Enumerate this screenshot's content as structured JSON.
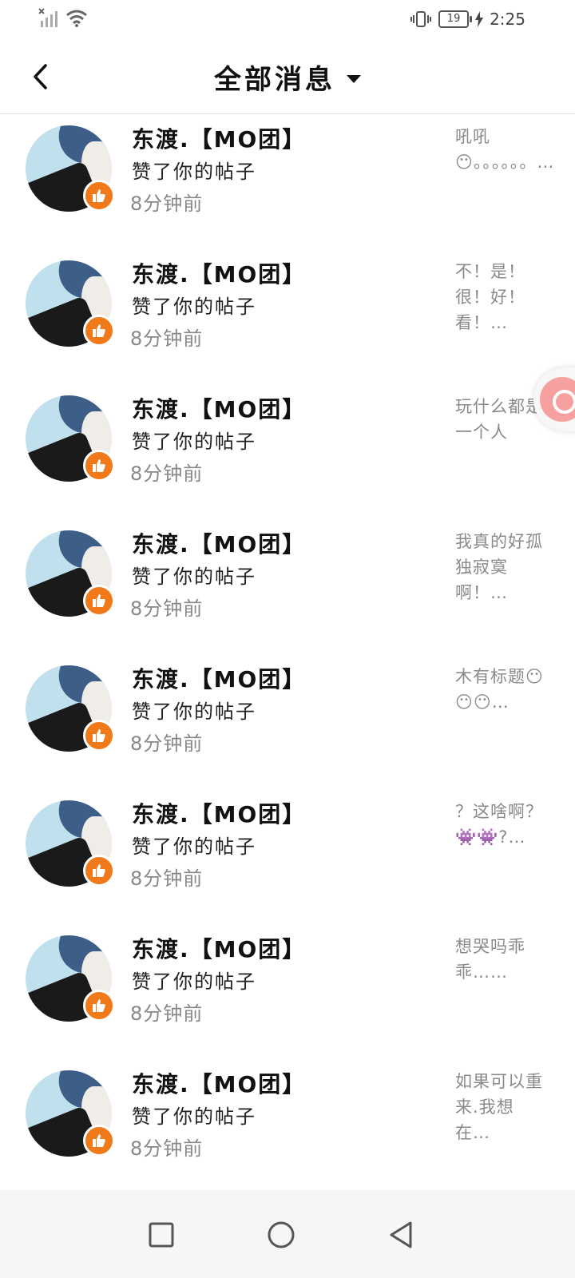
{
  "status_bar": {
    "time": "2:25",
    "battery": "19"
  },
  "header": {
    "title": "全部消息"
  },
  "items": [
    {
      "name": "东渡.【MO团】",
      "action": "赞了你的帖子",
      "time": "8分钟前",
      "preview": "吼吼😶。。。。。。…"
    },
    {
      "name": "东渡.【MO团】",
      "action": "赞了你的帖子",
      "time": "8分钟前",
      "preview": "不！是！很！好！看！…"
    },
    {
      "name": "东渡.【MO团】",
      "action": "赞了你的帖子",
      "time": "8分钟前",
      "preview": "玩什么都是一个人"
    },
    {
      "name": "东渡.【MO团】",
      "action": "赞了你的帖子",
      "time": "8分钟前",
      "preview": "我真的好孤独寂寞啊！…"
    },
    {
      "name": "东渡.【MO团】",
      "action": "赞了你的帖子",
      "time": "8分钟前",
      "preview": "木有标题😶😶😶…"
    },
    {
      "name": "东渡.【MO团】",
      "action": "赞了你的帖子",
      "time": "8分钟前",
      "preview": "？这啥啊？👾👾?…"
    },
    {
      "name": "东渡.【MO团】",
      "action": "赞了你的帖子",
      "time": "8分钟前",
      "preview": "想哭吗乖乖……"
    },
    {
      "name": "东渡.【MO团】",
      "action": "赞了你的帖子",
      "time": "8分钟前",
      "preview": "如果可以重来.我想在…"
    },
    {
      "name": "东渡.【MO团】",
      "action": "",
      "time": "",
      "preview": ""
    }
  ],
  "nav": {
    "buttons": [
      "recent-apps",
      "home",
      "back"
    ]
  }
}
